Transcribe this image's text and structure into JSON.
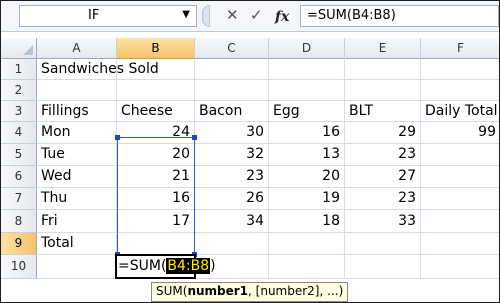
{
  "formula_bar": {
    "name_box": "IF",
    "cancel_glyph": "✕",
    "enter_glyph": "✓",
    "fx_glyph": "fx",
    "formula": "=SUM(B4:B8)"
  },
  "columns": [
    "A",
    "B",
    "C",
    "D",
    "E",
    "F"
  ],
  "rows": [
    "1",
    "2",
    "3",
    "4",
    "5",
    "6",
    "7",
    "8",
    "9",
    "10"
  ],
  "cells": {
    "A1": "Sandwiches Sold",
    "A3": "Fillings",
    "B3": "Cheese",
    "C3": "Bacon",
    "D3": "Egg",
    "E3": "BLT",
    "F3": "Daily Total",
    "A4": "Mon",
    "B4": "24",
    "C4": "30",
    "D4": "16",
    "E4": "29",
    "F4": "99",
    "A5": "Tue",
    "B5": "20",
    "C5": "32",
    "D5": "13",
    "E5": "23",
    "A6": "Wed",
    "B6": "21",
    "C6": "23",
    "D6": "20",
    "E6": "27",
    "A7": "Thu",
    "B7": "16",
    "C7": "26",
    "D7": "19",
    "E7": "23",
    "A8": "Fri",
    "B8": "17",
    "C8": "34",
    "D8": "18",
    "E8": "33",
    "A9": "Total"
  },
  "edit": {
    "prefix": "=SUM(",
    "range": "B4:B8",
    "suffix": ")"
  },
  "tooltip": {
    "fn": "SUM(",
    "arg1": "number1",
    "rest": ", [number2], ...)"
  },
  "colors": {
    "selected_header": "#f3c36a",
    "range_border": "#3355dd",
    "tooltip_bg": "#ffffe1"
  }
}
